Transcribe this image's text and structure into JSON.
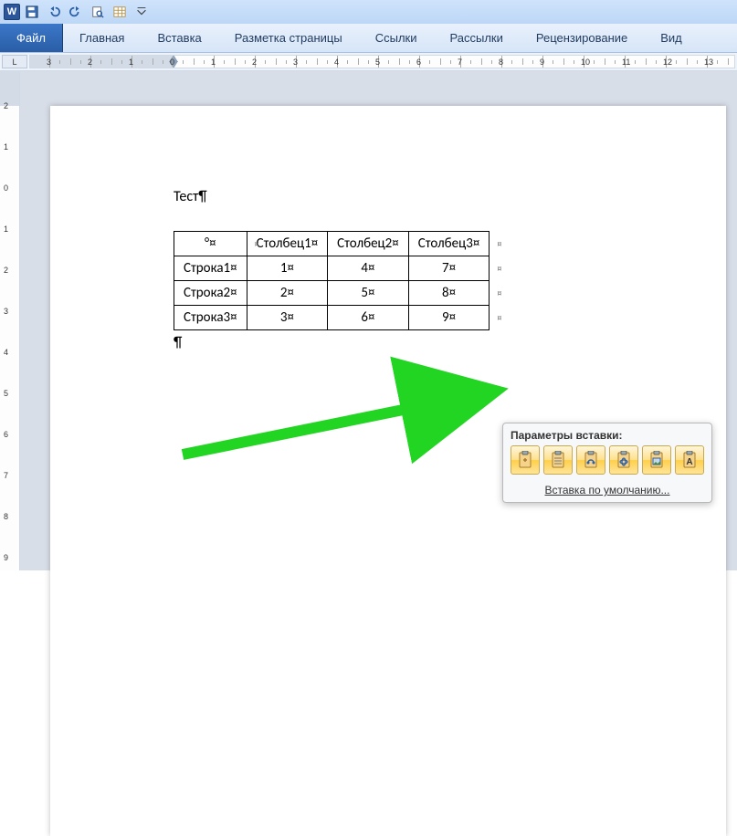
{
  "tabs": {
    "file": "Файл",
    "home": "Главная",
    "insert": "Вставка",
    "layout": "Разметка страницы",
    "references": "Ссылки",
    "mailings": "Рассылки",
    "review": "Рецензирование",
    "view": "Вид"
  },
  "ruler_corner": "L",
  "document": {
    "title": "Тест¶",
    "para_mark": "¶",
    "table": {
      "header": [
        "°¤",
        "Столбец1¤",
        "Столбец2¤",
        "Столбец3¤"
      ],
      "rows": [
        [
          "Строка1¤",
          "1¤",
          "4¤",
          "7¤"
        ],
        [
          "Строка2¤",
          "2¤",
          "5¤",
          "8¤"
        ],
        [
          "Строка3¤",
          "3¤",
          "6¤",
          "9¤"
        ]
      ]
    }
  },
  "paste_popup": {
    "title": "Параметры вставки:",
    "default_link": "Вставка по умолчанию..."
  }
}
